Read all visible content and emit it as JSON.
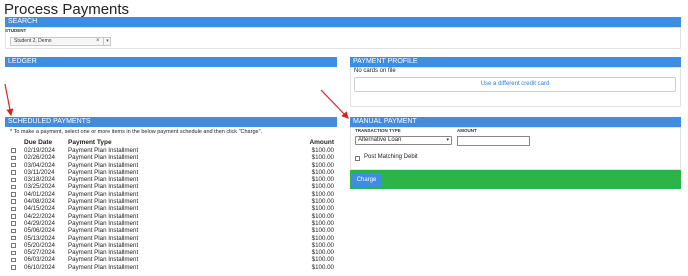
{
  "page": {
    "title": "Process Payments"
  },
  "search": {
    "header": "SEARCH",
    "student_label": "STUDENT",
    "student_value": "Student 2, Demo",
    "clear_glyph": "×",
    "caret_glyph": "▾"
  },
  "ledger": {
    "header": "LEDGER"
  },
  "payment_profile": {
    "header": "PAYMENT PROFILE",
    "no_cards": "No cards on file",
    "use_card_button": "Use a different credit card"
  },
  "scheduled": {
    "header": "SCHEDULED PAYMENTS",
    "note": "* To make a payment, select one or more items in the below payment schedule and then click \"Charge\".",
    "columns": {
      "due_date": "Due Date",
      "payment_type": "Payment Type",
      "amount": "Amount"
    },
    "rows": [
      {
        "date": "02/19/2024",
        "type": "Payment Plan Installment",
        "amount": "$100.00"
      },
      {
        "date": "02/26/2024",
        "type": "Payment Plan Installment",
        "amount": "$100.00"
      },
      {
        "date": "03/04/2024",
        "type": "Payment Plan Installment",
        "amount": "$100.00"
      },
      {
        "date": "03/11/2024",
        "type": "Payment Plan Installment",
        "amount": "$100.00"
      },
      {
        "date": "03/18/2024",
        "type": "Payment Plan Installment",
        "amount": "$100.00"
      },
      {
        "date": "03/25/2024",
        "type": "Payment Plan Installment",
        "amount": "$100.00"
      },
      {
        "date": "04/01/2024",
        "type": "Payment Plan Installment",
        "amount": "$100.00"
      },
      {
        "date": "04/08/2024",
        "type": "Payment Plan Installment",
        "amount": "$100.00"
      },
      {
        "date": "04/15/2024",
        "type": "Payment Plan Installment",
        "amount": "$100.00"
      },
      {
        "date": "04/22/2024",
        "type": "Payment Plan Installment",
        "amount": "$100.00"
      },
      {
        "date": "04/29/2024",
        "type": "Payment Plan Installment",
        "amount": "$100.00"
      },
      {
        "date": "05/06/2024",
        "type": "Payment Plan Installment",
        "amount": "$100.00"
      },
      {
        "date": "05/13/2024",
        "type": "Payment Plan Installment",
        "amount": "$100.00"
      },
      {
        "date": "05/20/2024",
        "type": "Payment Plan Installment",
        "amount": "$100.00"
      },
      {
        "date": "05/27/2024",
        "type": "Payment Plan Installment",
        "amount": "$100.00"
      },
      {
        "date": "06/03/2024",
        "type": "Payment Plan Installment",
        "amount": "$100.00"
      },
      {
        "date": "06/10/2024",
        "type": "Payment Plan Installment",
        "amount": "$100.00"
      }
    ]
  },
  "manual_payment": {
    "header": "MANUAL PAYMENT",
    "transaction_type_label": "TRANSACTION TYPE",
    "amount_label": "AMOUNT",
    "transaction_type_value": "Alternative Loan",
    "amount_value": "",
    "post_matching_debit_label": "Post Matching Debit",
    "charge_button": "Charge"
  },
  "colors": {
    "header_blue": "#3f8ce0",
    "charge_bar_green": "#2db449",
    "annotation_arrow_red": "#e02020",
    "link_blue": "#2f7fd6"
  }
}
